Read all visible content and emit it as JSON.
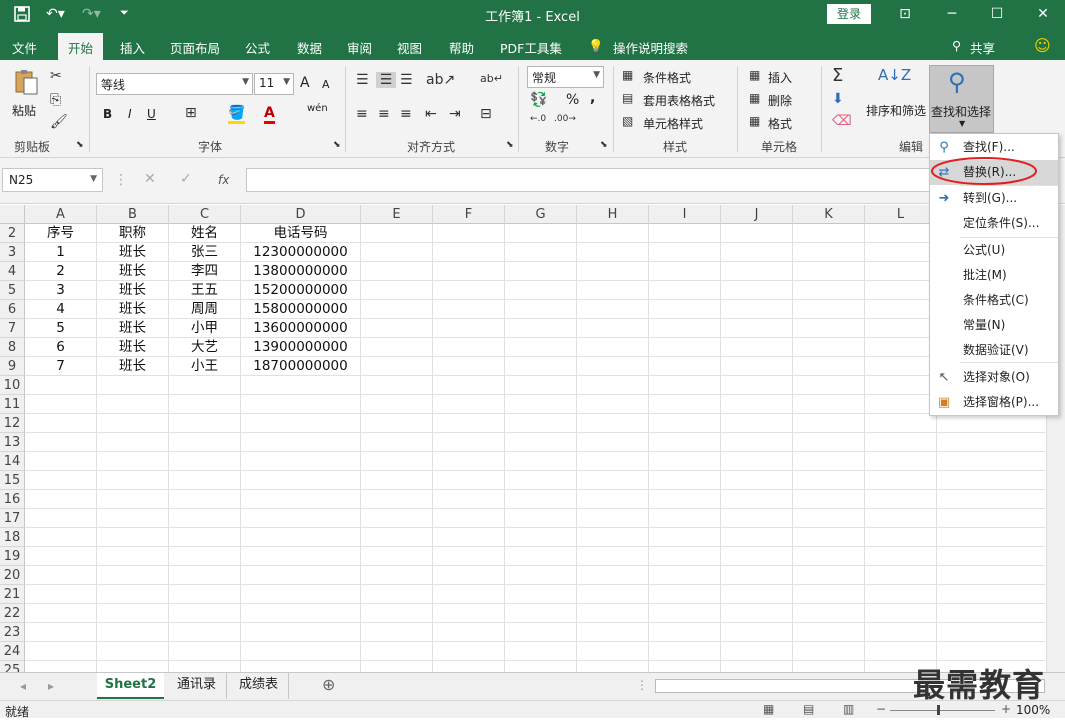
{
  "titlebar": {
    "title": "工作簿1  -  Excel",
    "login": "登录"
  },
  "tabs": [
    "文件",
    "开始",
    "插入",
    "页面布局",
    "公式",
    "数据",
    "审阅",
    "视图",
    "帮助",
    "PDF工具集",
    "操作说明搜索"
  ],
  "share": "共享",
  "ribbon": {
    "clipboard": {
      "paste": "粘贴",
      "label": "剪贴板"
    },
    "font": {
      "name": "等线",
      "size": "11",
      "label": "字体",
      "bold": "B",
      "italic": "I",
      "underline": "U",
      "grow": "A",
      "shrink": "A",
      "wen": "wén"
    },
    "align": {
      "label": "对齐方式"
    },
    "number": {
      "format": "常规",
      "percent": "%",
      "comma": ",",
      "label": "数字"
    },
    "styles": {
      "cond": "条件格式",
      "table": "套用表格格式",
      "cell": "单元格样式",
      "label": "样式"
    },
    "cells": {
      "insert": "插入",
      "delete": "删除",
      "format": "格式",
      "label": "单元格"
    },
    "edit": {
      "sort": "排序和筛选",
      "find": "查找和选择",
      "label": "编辑"
    }
  },
  "formula_bar": {
    "name_box": "N25",
    "fx": "fx",
    "formula": ""
  },
  "columns": [
    "A",
    "B",
    "C",
    "D",
    "E",
    "F",
    "G",
    "H",
    "I",
    "J",
    "K",
    "L"
  ],
  "row_numbers": [
    "2",
    "3",
    "4",
    "5",
    "6",
    "7",
    "8",
    "9",
    "10",
    "11",
    "12",
    "13",
    "14",
    "15",
    "16",
    "17",
    "18",
    "19",
    "20",
    "21",
    "22",
    "23",
    "24",
    "25"
  ],
  "table": [
    [
      "序号",
      "职称",
      "姓名",
      "电话号码"
    ],
    [
      "1",
      "班长",
      "张三",
      "12300000000"
    ],
    [
      "2",
      "班长",
      "李四",
      "13800000000"
    ],
    [
      "3",
      "班长",
      "王五",
      "15200000000"
    ],
    [
      "4",
      "班长",
      "周周",
      "15800000000"
    ],
    [
      "5",
      "班长",
      "小甲",
      "13600000000"
    ],
    [
      "6",
      "班长",
      "大艺",
      "13900000000"
    ],
    [
      "7",
      "班长",
      "小王",
      "18700000000"
    ]
  ],
  "menu": [
    {
      "label": "查找(F)...",
      "icon": "magnifier-icon"
    },
    {
      "label": "替换(R)...",
      "icon": "replace-icon"
    },
    {
      "label": "转到(G)...",
      "icon": "arrow-right-icon"
    },
    {
      "label": "定位条件(S)...",
      "icon": ""
    },
    {
      "label": "公式(U)",
      "icon": ""
    },
    {
      "label": "批注(M)",
      "icon": ""
    },
    {
      "label": "条件格式(C)",
      "icon": ""
    },
    {
      "label": "常量(N)",
      "icon": ""
    },
    {
      "label": "数据验证(V)",
      "icon": ""
    },
    {
      "label": "选择对象(O)",
      "icon": "cursor-icon"
    },
    {
      "label": "选择窗格(P)...",
      "icon": "selection-pane-icon"
    }
  ],
  "sheets": [
    "Sheet2",
    "通讯录",
    "成绩表"
  ],
  "status": {
    "ready": "就绪",
    "zoom": "100%"
  },
  "watermark": "最需教育",
  "colors": {
    "accent": "#217346",
    "highlight_circle": "#e02020"
  }
}
